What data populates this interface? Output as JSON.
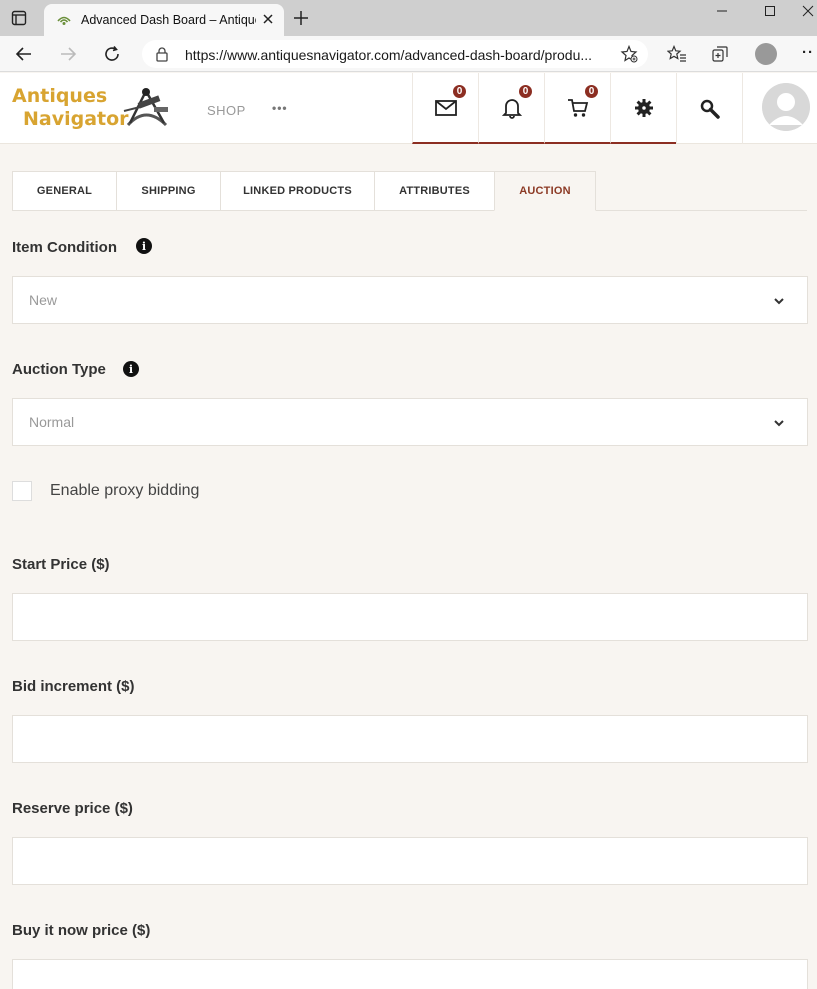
{
  "browser": {
    "tab_title": "Advanced Dash Board – Antiques Navigator",
    "url": "https://www.antiquesnavigator.com/advanced-dash-board/produ..."
  },
  "site": {
    "logo_line1": "Antiques",
    "logo_line2": "Navigator",
    "nav_shop": "SHOP",
    "nav_more": "•••",
    "badges": {
      "messages": "0",
      "notifications": "0",
      "cart": "0"
    }
  },
  "tabs": [
    {
      "label": "GENERAL"
    },
    {
      "label": "SHIPPING"
    },
    {
      "label": "LINKED PRODUCTS"
    },
    {
      "label": "ATTRIBUTES"
    },
    {
      "label": "AUCTION",
      "active": true
    }
  ],
  "form": {
    "item_condition": {
      "label": "Item Condition",
      "value": "New"
    },
    "auction_type": {
      "label": "Auction Type",
      "value": "Normal"
    },
    "proxy_bidding": {
      "label": "Enable proxy bidding",
      "checked": false
    },
    "start_price": {
      "label": "Start Price ($)",
      "value": ""
    },
    "bid_increment": {
      "label": "Bid increment ($)",
      "value": ""
    },
    "reserve_price": {
      "label": "Reserve price ($)",
      "value": ""
    },
    "buy_now_price": {
      "label": "Buy it now price ($)",
      "value": ""
    }
  },
  "colors": {
    "accent": "#8c2e22",
    "logo": "#d8a431",
    "page_bg": "#f8f5f1"
  }
}
